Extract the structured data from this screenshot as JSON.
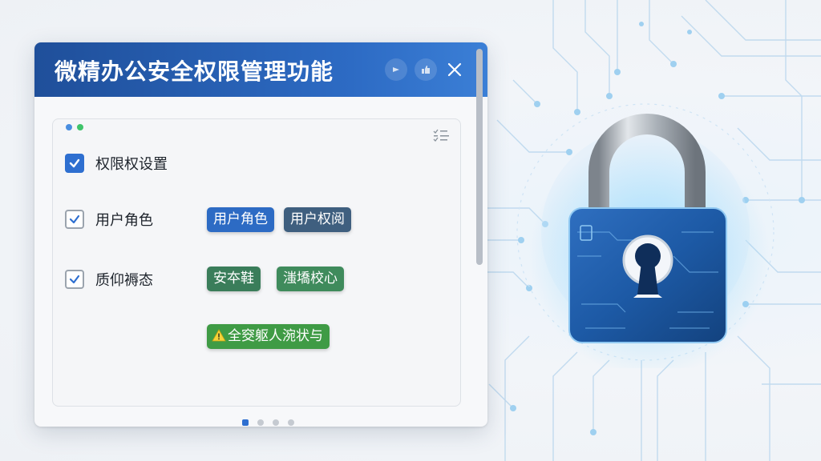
{
  "window": {
    "title": "微精办公安全权限管理功能",
    "buttons": [
      {
        "icon": "pin-icon"
      },
      {
        "icon": "thumbs-icon"
      },
      {
        "icon": "close-icon"
      }
    ]
  },
  "panel": {
    "top_icon": "checklist-icon",
    "rows": [
      {
        "label": "权限权设置",
        "checked": true,
        "style": "filled"
      },
      {
        "label": "用户角色",
        "checked": true,
        "style": "outline"
      },
      {
        "label": "质仰褥态",
        "checked": true,
        "style": "outline"
      }
    ],
    "tags_row1": [
      {
        "label": "用户角色",
        "color": "#2d6bc4"
      },
      {
        "label": "用户权阅",
        "color": "#3f5f7f"
      }
    ],
    "tags_row2": [
      {
        "label": "安夲鞋",
        "color": "#3a7d5a"
      },
      {
        "label": "滍墧校心",
        "color": "#3f8b5c"
      }
    ],
    "alert_tag": {
      "label": "全窔躯人涴状与",
      "icon": "warning-icon",
      "color": "#3f9b45"
    },
    "pager": {
      "count": 4,
      "active": 0
    }
  },
  "colors": {
    "title_bar": "#1f4f9a",
    "accent": "#2e6fd0",
    "lock_body": "#1d5aa6"
  }
}
